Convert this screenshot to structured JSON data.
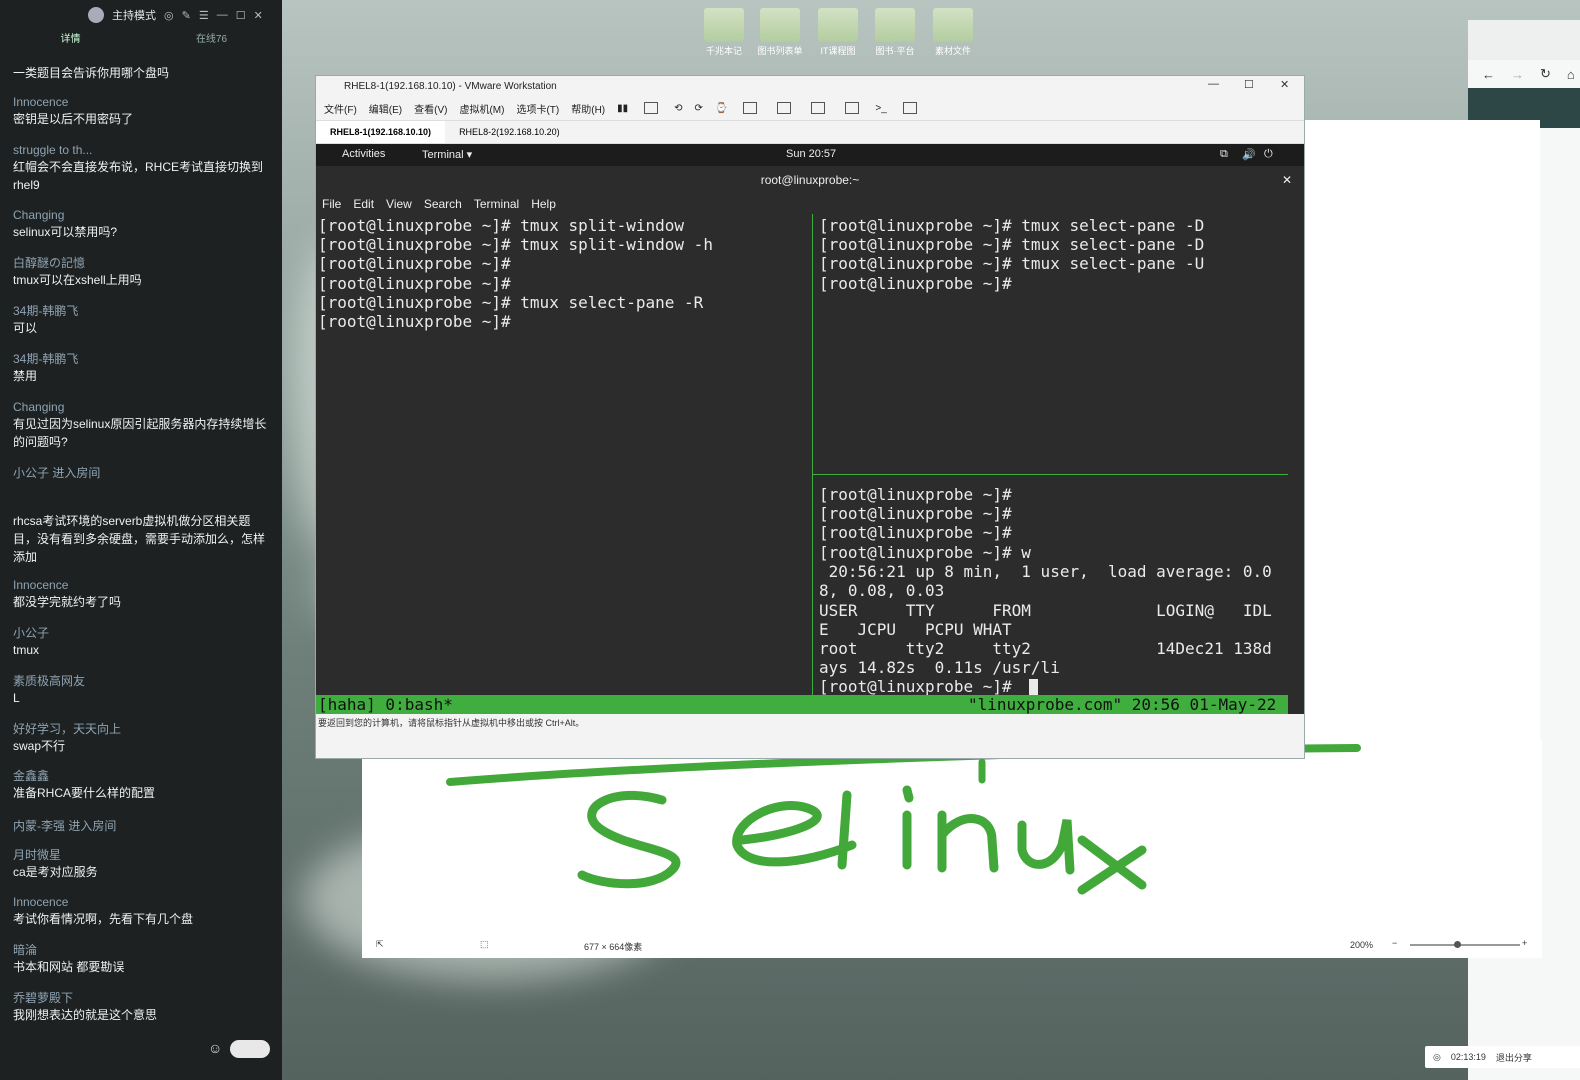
{
  "chat": {
    "header": {
      "mode": "主持模式"
    },
    "tabs": {
      "detail": "详情",
      "online": "在线76"
    },
    "messages": [
      {
        "name": "",
        "text": "一类题目会告诉你用哪个盘吗"
      },
      {
        "name": "Innocence",
        "text": "密钥是以后不用密码了"
      },
      {
        "name": "struggle to th...",
        "text": "红帽会不会直接发布说，RHCE考试直接切换到rhel9"
      },
      {
        "name": "Changing",
        "text": "selinux可以禁用吗?"
      },
      {
        "name": "白醇醚の記憶",
        "text": "tmux可以在xshell上用吗"
      },
      {
        "name": "34期-韩鹏飞",
        "text": "可以"
      },
      {
        "name": "34期-韩鹏飞",
        "text": "禁用"
      },
      {
        "name": "Changing",
        "text": "有见过因为selinux原因引起服务器内存持续增长的问题吗?"
      },
      {
        "name": "",
        "system": "小公子 进入房间"
      },
      {
        "name": "",
        "text": "rhcsa考试环境的serverb虚拟机做分区相关题目，没有看到多余硬盘，需要手动添加么，怎样添加"
      },
      {
        "name": "Innocence",
        "text": "都没学完就约考了吗"
      },
      {
        "name": "小公子",
        "text": "tmux"
      },
      {
        "name": "素质极高网友",
        "text": "L"
      },
      {
        "name": "好好学习，天天向上",
        "text": "swap不行"
      },
      {
        "name": "金鑫鑫",
        "text": "准备RHCA要什么样的配置"
      },
      {
        "name": "",
        "system": "内蒙-李强 进入房间"
      },
      {
        "name": "月时微星",
        "text": "ca是考对应服务"
      },
      {
        "name": "Innocence",
        "text": "考试你看情况啊，先看下有几个盘"
      },
      {
        "name": "暗淪",
        "text": "书本和网站 都要勘误"
      },
      {
        "name": "乔碧萝殿下",
        "text": "我刚想表达的就是这个意思"
      }
    ]
  },
  "desktop": {
    "icons": [
      "千兆本记",
      "图书列表单",
      "IT课程图",
      "图书·平台",
      "素材文件"
    ]
  },
  "vmware": {
    "title": "RHEL8-1(192.168.10.10) - VMware Workstation",
    "menu": [
      "文件(F)",
      "编辑(E)",
      "查看(V)",
      "虚拟机(M)",
      "选项卡(T)",
      "帮助(H)"
    ],
    "tabs": [
      "RHEL8-1(192.168.10.10)",
      "RHEL8-2(192.168.10.20)"
    ],
    "status_hint": "要返回到您的计算机，请将鼠标指针从虚拟机中移出或按 Ctrl+Alt。"
  },
  "gnome": {
    "activities": "Activities",
    "app": "Terminal ▾",
    "clock": "Sun 20:57"
  },
  "terminal": {
    "title": "root@linuxprobe:~",
    "menu": [
      "File",
      "Edit",
      "View",
      "Search",
      "Terminal",
      "Help"
    ],
    "left_pane": [
      "[root@linuxprobe ~]# tmux split-window",
      "[root@linuxprobe ~]# tmux split-window -h",
      "[root@linuxprobe ~]#",
      "[root@linuxprobe ~]#",
      "[root@linuxprobe ~]# tmux select-pane -R",
      "[root@linuxprobe ~]#"
    ],
    "top_right_pane": [
      "[root@linuxprobe ~]# tmux select-pane -D",
      "[root@linuxprobe ~]# tmux select-pane -D",
      "[root@linuxprobe ~]# tmux select-pane -U",
      "[root@linuxprobe ~]#"
    ],
    "bottom_right_pane": [
      "[root@linuxprobe ~]#",
      "[root@linuxprobe ~]#",
      "[root@linuxprobe ~]#",
      "[root@linuxprobe ~]# w",
      " 20:56:21 up 8 min,  1 user,  load average: 0.0",
      "8, 0.08, 0.03",
      "USER     TTY      FROM             LOGIN@   IDL",
      "E   JCPU   PCPU WHAT",
      "root     tty2     tty2             14Dec21 138d",
      "ays 14.82s  0.11s /usr/li",
      "[root@linuxprobe ~]# "
    ],
    "status_left": "[haha] 0:bash*",
    "status_right": "\"linuxprobe.com\" 20:56 01-May-22"
  },
  "drawing": {
    "annotation": "selinux",
    "dims": "677 × 664像素",
    "zoom": "200%",
    "ink_color": "#43a83a"
  },
  "taskbar": {
    "timer": "02:13:19",
    "exit": "退出分享"
  }
}
